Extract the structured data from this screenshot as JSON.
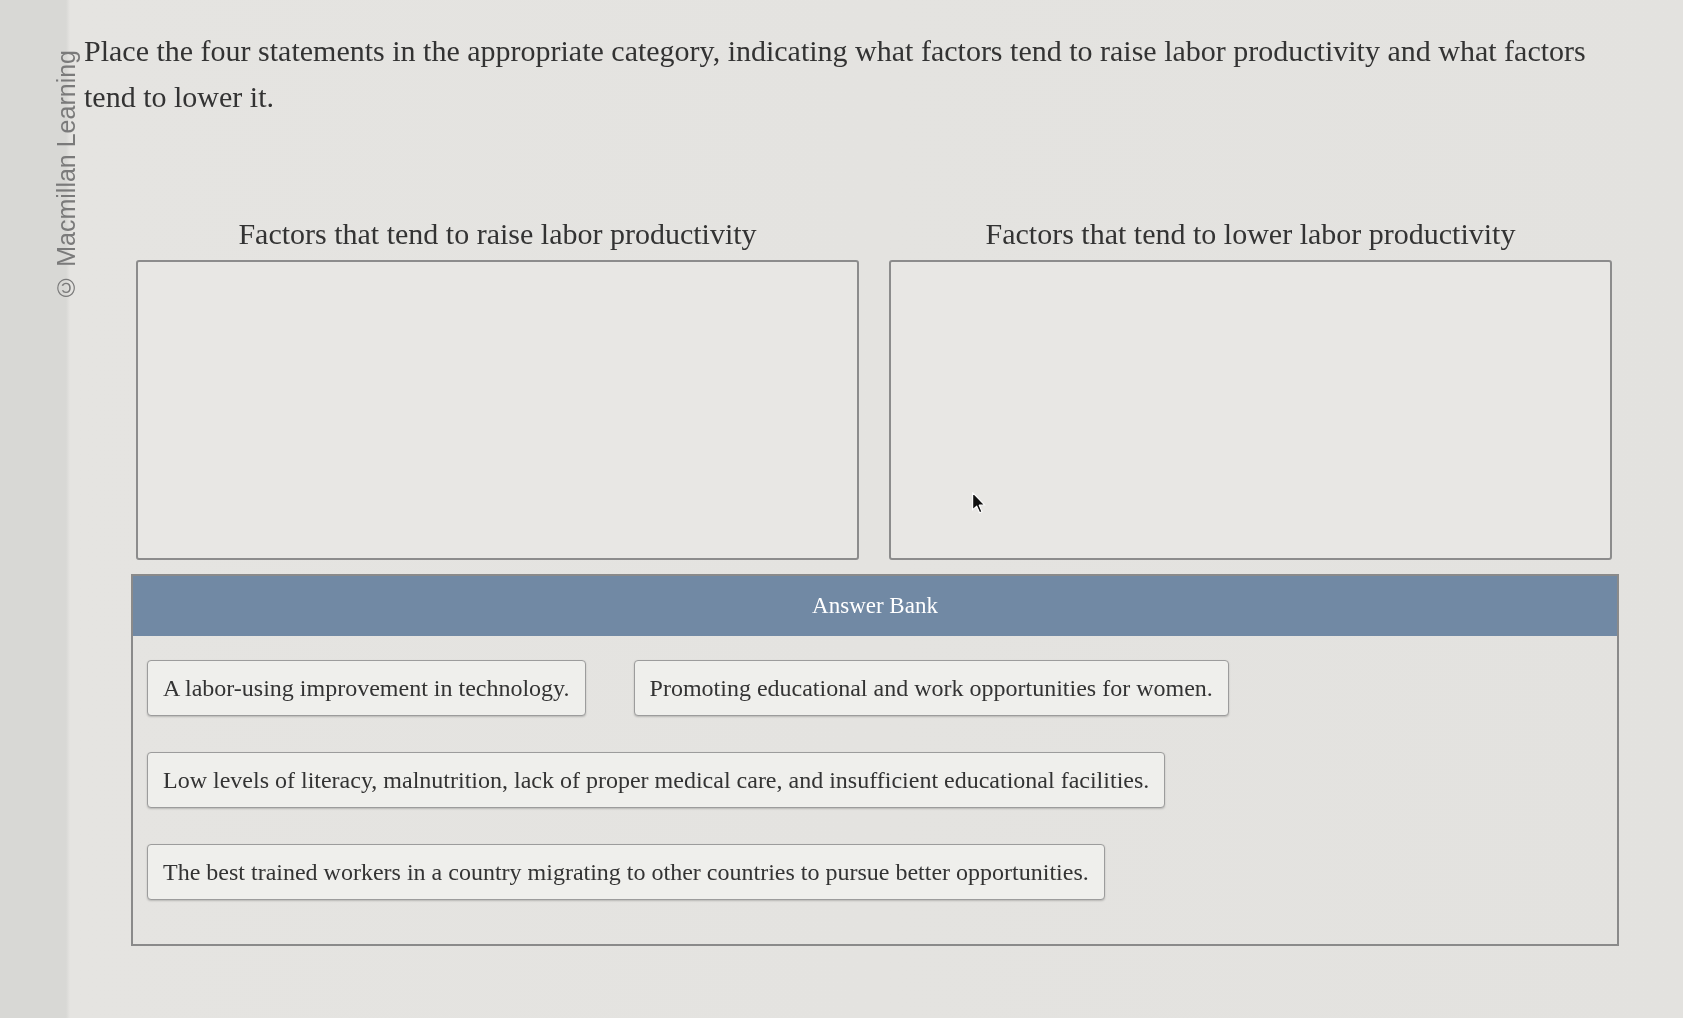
{
  "credit": "© Macmillan Learning",
  "instructions": "Place the four statements in the appropriate category, indicating what factors tend to raise labor productivity and what factors tend to lower it.",
  "categories": [
    {
      "heading": "Factors that tend to raise labor productivity"
    },
    {
      "heading": "Factors that tend to lower labor productivity"
    }
  ],
  "answer_bank": {
    "title": "Answer Bank",
    "items": [
      "A labor-using improvement in technology.",
      "Promoting educational and work opportunities for women.",
      "Low levels of literacy, malnutrition, lack of proper medical care, and insufficient educational facilities.",
      "The best trained workers in a country migrating to other countries to pursue better opportunities."
    ]
  }
}
